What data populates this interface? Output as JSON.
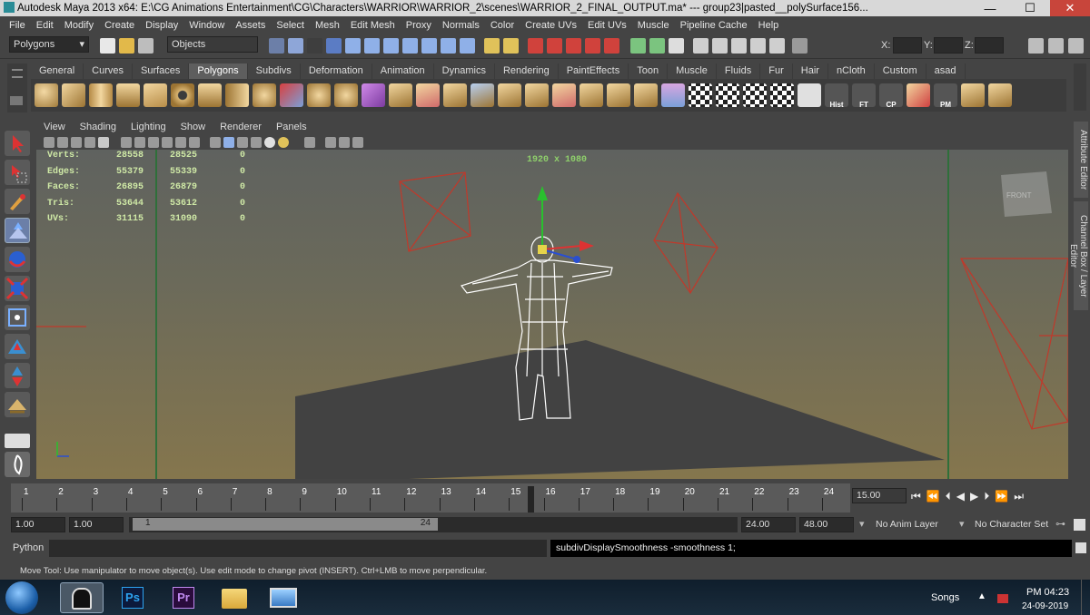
{
  "window": {
    "title": "Autodesk Maya 2013 x64: E:\\CG Animations Entertainment\\CG\\Characters\\WARRIOR\\WARRIOR_2\\scenes\\WARRIOR_2_FINAL_OUTPUT.ma*   ---   group23|pasted__polySurface156...",
    "minimize": "—",
    "maximize": "☐",
    "close": "✕"
  },
  "menubar": [
    "File",
    "Edit",
    "Modify",
    "Create",
    "Display",
    "Window",
    "Assets",
    "Select",
    "Mesh",
    "Edit Mesh",
    "Proxy",
    "Normals",
    "Color",
    "Create UVs",
    "Edit UVs",
    "Muscle",
    "Pipeline Cache",
    "Help"
  ],
  "statusline": {
    "menu_set": "Polygons",
    "selection_mode": "Objects",
    "x_label": "X:",
    "y_label": "Y:",
    "z_label": "Z:"
  },
  "shelf_tabs": [
    "General",
    "Curves",
    "Surfaces",
    "Polygons",
    "Subdivs",
    "Deformation",
    "Animation",
    "Dynamics",
    "Rendering",
    "PaintEffects",
    "Toon",
    "Muscle",
    "Fluids",
    "Fur",
    "Hair",
    "nCloth",
    "Custom",
    "asad"
  ],
  "shelf_active": "Polygons",
  "shelf_labels": {
    "hist": "Hist",
    "ft": "FT",
    "cp": "CP",
    "pm": "PM"
  },
  "panel_menu": [
    "View",
    "Shading",
    "Lighting",
    "Show",
    "Renderer",
    "Panels"
  ],
  "hud": {
    "rows": [
      {
        "label": "Verts:",
        "a": "28558",
        "b": "28525",
        "c": "0"
      },
      {
        "label": "Edges:",
        "a": "55379",
        "b": "55339",
        "c": "0"
      },
      {
        "label": "Faces:",
        "a": "26895",
        "b": "26879",
        "c": "0"
      },
      {
        "label": "Tris:",
        "a": "53644",
        "b": "53612",
        "c": "0"
      },
      {
        "label": "UVs:",
        "a": "31115",
        "b": "31090",
        "c": "0"
      }
    ],
    "resolution": "1920 x 1080",
    "view_cube": "FRONT"
  },
  "right_tabs": [
    "Attribute Editor",
    "Channel Box / Layer Editor"
  ],
  "timeline": {
    "ticks": [
      "1",
      "2",
      "3",
      "4",
      "5",
      "6",
      "7",
      "8",
      "9",
      "10",
      "11",
      "12",
      "13",
      "14",
      "15",
      "16",
      "17",
      "18",
      "19",
      "20",
      "21",
      "22",
      "23",
      "24"
    ],
    "current_frame": "15.00"
  },
  "range": {
    "start": "1.00",
    "playback_start": "1.00",
    "slider_start": "1",
    "slider_end": "24",
    "playback_end": "24.00",
    "end": "48.00",
    "anim_layer": "No Anim Layer",
    "char_set": "No Character Set"
  },
  "cmdline": {
    "label": "Python",
    "result": "subdivDisplaySmoothness -smoothness 1;"
  },
  "helpline": "Move Tool: Use manipulator to move object(s). Use edit mode to change pivot (INSERT).  Ctrl+LMB to move perpendicular.",
  "taskbar": {
    "tray_label": "Songs",
    "time": "PM 04:23",
    "date": "24-09-2019",
    "ps": "Ps",
    "pr": "Pr"
  },
  "colors": {
    "accent": "#5e5e5e",
    "grid_green": "#2f6f3a",
    "wire_red": "#c0392b"
  }
}
